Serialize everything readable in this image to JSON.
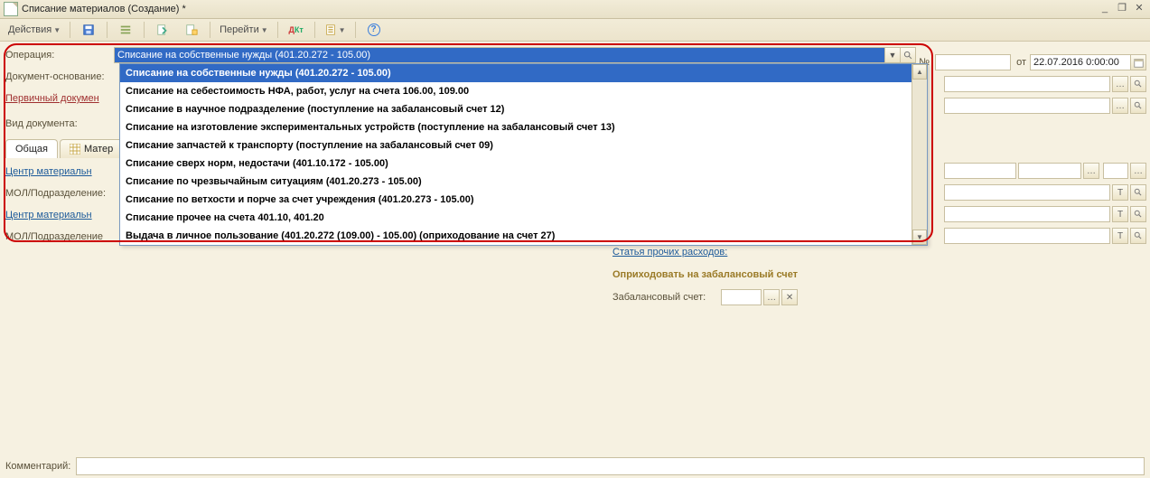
{
  "window": {
    "title": "Списание материалов (Создание) *"
  },
  "toolbar": {
    "actions_label": "Действия",
    "goto_label": "Перейти"
  },
  "fields": {
    "operation_label": "Операция:",
    "operation_value": "Списание на собственные нужды (401.20.272 - 105.00)",
    "basis_label": "Документ-основание:",
    "primary_label": "Первичный докумен",
    "doctype_label": "Вид документа:",
    "number_label": "№",
    "from_label": "от",
    "datetime_value": "22.07.2016  0:00:00",
    "center1_label": "Центр материальн",
    "mol1_label": "МОЛ/Подразделение:",
    "center2_label": "Центр материальн",
    "mol2_label": "МОЛ/Подразделение",
    "other_exp_label": "Статья прочих расходов:",
    "offbal_heading": "Оприходовать на забалансовый счет",
    "offbal_label": "Забалансовый счет:",
    "comment_label": "Комментарий:"
  },
  "tabs": {
    "common": "Общая",
    "materials": "Матер"
  },
  "dropdown": {
    "items": [
      "Списание на собственные нужды (401.20.272 - 105.00)",
      "Списание на себестоимость НФА, работ, услуг на счета 106.00, 109.00",
      "Списание в научное подразделение (поступление на забалансовый счет 12)",
      "Списание на изготовление экспериментальных устройств (поступление на забалансовый счет 13)",
      "Списание запчастей к транспорту (поступление на забалансовый счет 09)",
      "Списание сверх норм, недостачи (401.10.172 - 105.00)",
      "Списание по чрезвычайным ситуациям (401.20.273 - 105.00)",
      "Списание по ветхости и порче за счет учреждения (401.20.273 - 105.00)",
      "Списание прочее на счета 401.10, 401.20",
      "Выдача в личное пользование (401.20.272 (109.00) - 105.00) (оприходование на счет 27)"
    ]
  }
}
